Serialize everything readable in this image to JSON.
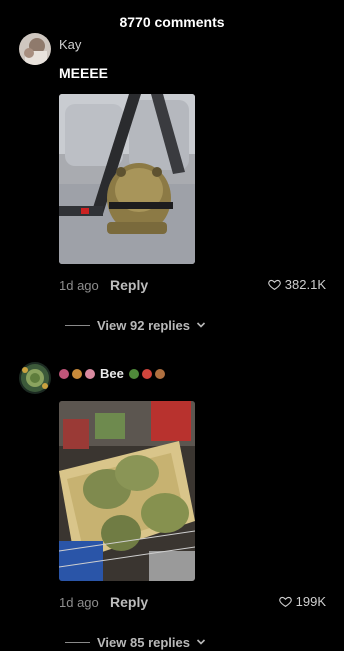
{
  "header": {
    "title": "8770 comments"
  },
  "comments": [
    {
      "username": "Kay",
      "text": "MEEEE",
      "time": "1d ago",
      "reply_label": "Reply",
      "likes": "382.1K",
      "view_replies": "View 92 replies",
      "photo_desc": "frog statue buckled in car seat"
    },
    {
      "username": "Bee",
      "emojis_before": [
        "flower-icon",
        "bear-icon",
        "mushroom-icon"
      ],
      "emojis_after": [
        "frog-icon",
        "mushroom-icon",
        "bear-icon"
      ],
      "text": "",
      "time": "1d ago",
      "reply_label": "Reply",
      "likes": "199K",
      "view_replies": "View 85 replies",
      "photo_desc": "frog statues in shopping cart basket"
    }
  ],
  "colors": {
    "background": "#000000",
    "text": "#ffffff",
    "muted": "#8e8e8e"
  }
}
